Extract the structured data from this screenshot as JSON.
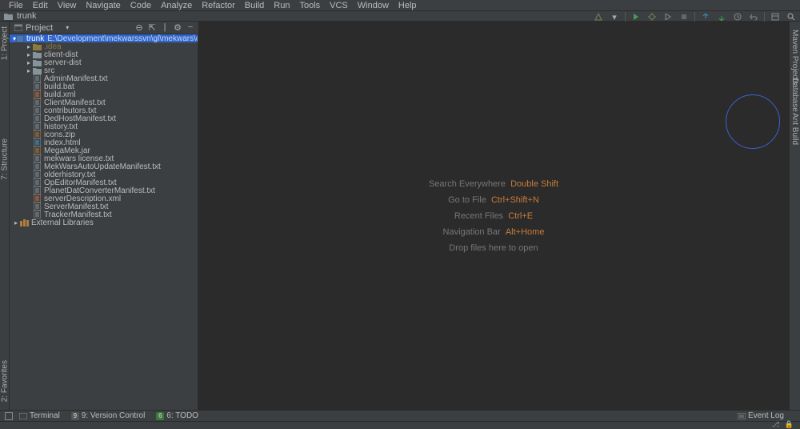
{
  "menu": [
    "File",
    "Edit",
    "View",
    "Navigate",
    "Code",
    "Analyze",
    "Refactor",
    "Build",
    "Run",
    "Tools",
    "VCS",
    "Window",
    "Help"
  ],
  "breadcrumb": {
    "label": "trunk"
  },
  "project_panel": {
    "title": "Project"
  },
  "tree": {
    "root": {
      "name": "trunk",
      "path": "E:\\Development\\mekwarssvn\\gl\\mekwars\\code\\trunk"
    },
    "folders": [
      {
        "name": ".idea"
      },
      {
        "name": "client-dist"
      },
      {
        "name": "server-dist"
      },
      {
        "name": "src"
      }
    ],
    "files": [
      "AdminManifest.txt",
      "build.bat",
      "build.xml",
      "ClientManifest.txt",
      "contributors.txt",
      "DedHostManifest.txt",
      "history.txt",
      "icons.zip",
      "index.html",
      "MegaMek.jar",
      "mekwars license.txt",
      "MekWarsAutoUpdateManifest.txt",
      "olderhistory.txt",
      "OpEditorManifest.txt",
      "PlanetDatConverterManifest.txt",
      "serverDescription.xml",
      "ServerManifest.txt",
      "TrackerManifest.txt"
    ],
    "ext_lib": "External Libraries"
  },
  "editor_hints": [
    {
      "label": "Search Everywhere",
      "shortcut": "Double Shift"
    },
    {
      "label": "Go to File",
      "shortcut": "Ctrl+Shift+N"
    },
    {
      "label": "Recent Files",
      "shortcut": "Ctrl+E"
    },
    {
      "label": "Navigation Bar",
      "shortcut": "Alt+Home"
    },
    {
      "label": "Drop files here to open",
      "shortcut": ""
    }
  ],
  "left_tabs": {
    "project": "1: Project",
    "structure": "7: Structure",
    "favorites": "2: Favorites"
  },
  "right_tabs": {
    "maven": "Maven Projects",
    "database": "Database",
    "ant": "Ant Build"
  },
  "status": {
    "terminal": "Terminal",
    "vcs": "9: Version Control",
    "todo": "6: TODO",
    "event_log": "Event Log"
  }
}
